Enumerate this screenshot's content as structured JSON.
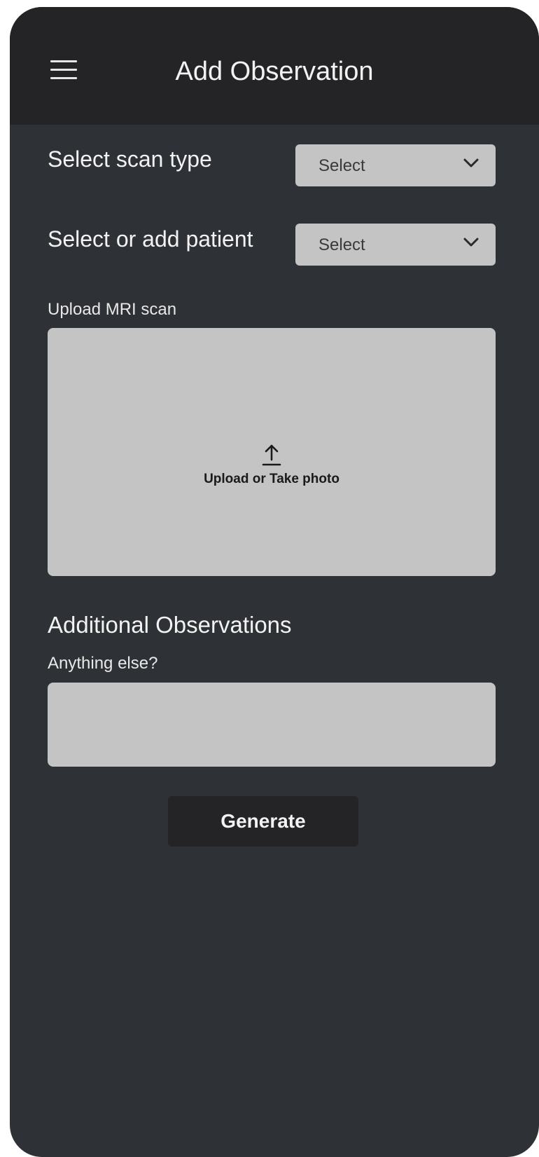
{
  "header": {
    "title": "Add Observation",
    "menu_icon": "hamburger-menu-icon"
  },
  "form": {
    "scan_type": {
      "label": "Select scan type",
      "value": "Select"
    },
    "patient": {
      "label": "Select or add patient",
      "value": "Select"
    },
    "upload": {
      "label": "Upload MRI scan",
      "action_text": "Upload or Take photo",
      "icon": "upload-icon"
    },
    "additional": {
      "heading": "Additional Observations",
      "label": "Anything else?",
      "value": ""
    },
    "generate_label": "Generate"
  },
  "colors": {
    "background": "#2e3135",
    "header": "#242427",
    "field": "#c4c4c4",
    "text": "#f2f2f2"
  }
}
